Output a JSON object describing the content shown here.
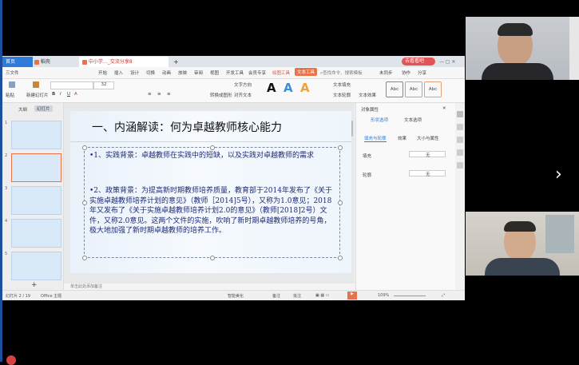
{
  "window": {
    "tabs": [
      "首页",
      "稻壳",
      "中小学…_交流分享8",
      "+"
    ],
    "top_right_label": "去看看吧"
  },
  "ribbon": {
    "menu_label": "三文件",
    "tabs": [
      "开始",
      "插入",
      "设计",
      "切换",
      "动画",
      "放映",
      "审阅",
      "视图",
      "开发工具",
      "会员专享",
      "绘图工具",
      "文本工具"
    ],
    "search_label": "查找命令、搜索模板",
    "right_items": [
      "未同步",
      "协作",
      "分享"
    ]
  },
  "toolbar": {
    "paste": "粘贴",
    "new_slide": "新建幻灯片",
    "format_painter": "格式刷",
    "font_size": "32",
    "text_direction": "文字方向",
    "align_text": "对齐文本",
    "convert_smartart": "转换成图形",
    "text_fill": "文本填充",
    "text_outline": "文本轮廓",
    "text_effect": "文本效果",
    "style_samples": [
      "A",
      "A",
      "A"
    ],
    "shape_styles": [
      "Abc",
      "Abc",
      "Abc"
    ]
  },
  "left_pane": {
    "tabs": [
      "大纲",
      "幻灯片"
    ],
    "slide_numbers": [
      "1",
      "2",
      "3",
      "4",
      "5"
    ],
    "add_label": "+"
  },
  "slide": {
    "title": "一、内涵解读：何为卓越教师核心能力",
    "para1": "•1、实践背景：卓越教师在实践中的短缺，以及实践对卓越教师的需求",
    "para2": "•2、政策背景：为提高新时期教师培养质量，教育部于2014年发布了《关于实施卓越教师培养计划的意见》（教师［2014]5号），又称为1.0意见；2018年又发布了《关于实施卓越教师培养计划2.0的意见》（教师[2018]2号）文件，又称2.0意见。这两个文件的实施，吹响了新时期卓越教师培养的号角，极大地加强了新时期卓越教师的培养工作。"
  },
  "notes": {
    "placeholder": "单击此处添加备注"
  },
  "right_pane": {
    "title": "对象属性",
    "tabs": [
      "形状选项",
      "文本选项"
    ],
    "sub_tabs": [
      "填充与轮廓",
      "效果",
      "大小与属性"
    ],
    "rows": [
      {
        "label": "填充",
        "value": "无"
      },
      {
        "label": "轮廓",
        "value": "无"
      }
    ]
  },
  "status": {
    "slide_info": "幻灯片 2 / 19",
    "theme": "Office 主题",
    "smart_beautify": "智能美化",
    "notes_btn": "备注",
    "comment_btn": "批注",
    "zoom": "109%"
  },
  "colors": {
    "accent": "#e8734a",
    "slide_text": "#1c2a78",
    "title_text": "#111111"
  }
}
